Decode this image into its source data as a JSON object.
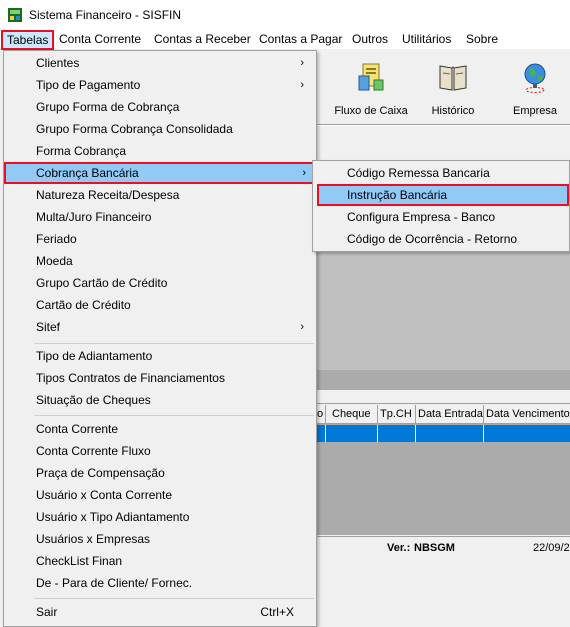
{
  "window": {
    "title": "Sistema Financeiro - SISFIN",
    "icon": "sisfin-app-icon"
  },
  "menubar": {
    "items": [
      "Tabelas",
      "Conta Corrente",
      "Contas a Receber",
      "Contas a Pagar",
      "Outros",
      "Utilitários",
      "Sobre"
    ]
  },
  "toolbar": {
    "buttons": [
      {
        "label": "Fluxo de Caixa",
        "icon": "cash-flow-icon"
      },
      {
        "label": "Histórico",
        "icon": "book-icon"
      },
      {
        "label": "Empresa",
        "icon": "globe-icon"
      }
    ]
  },
  "tabelas_menu": {
    "items": [
      {
        "label": "Clientes",
        "submenu": true
      },
      {
        "label": "Tipo de Pagamento",
        "submenu": true
      },
      {
        "label": "Grupo Forma de Cobrança"
      },
      {
        "label": "Grupo Forma Cobrança Consolidada"
      },
      {
        "label": "Forma Cobrança"
      },
      {
        "label": "Cobrança Bancária",
        "submenu": true,
        "highlighted": true
      },
      {
        "label": "Natureza Receita/Despesa"
      },
      {
        "label": "Multa/Juro Financeiro"
      },
      {
        "label": "Feriado"
      },
      {
        "label": "Moeda"
      },
      {
        "label": "Grupo Cartão de Crédito"
      },
      {
        "label": "Cartão de Crédito"
      },
      {
        "label": "Sitef",
        "submenu": true
      },
      {
        "label": "Tipo de Adiantamento"
      },
      {
        "label": "Tipos Contratos de Financiamentos"
      },
      {
        "label": "Situação de Cheques"
      },
      {
        "label": "Conta Corrente"
      },
      {
        "label": "Conta Corrente Fluxo"
      },
      {
        "label": "Praça de Compensação"
      },
      {
        "label": "Usuário x Conta Corrente"
      },
      {
        "label": "Usuário x Tipo Adiantamento"
      },
      {
        "label": "Usuários x Empresas"
      },
      {
        "label": "CheckList Finan"
      },
      {
        "label": "De - Para de Cliente/ Fornec."
      },
      {
        "label": "Sair",
        "shortcut": "Ctrl+X"
      }
    ],
    "arrow_glyph": "›"
  },
  "cobranca_submenu": {
    "items": [
      {
        "label": "Código Remessa Bancaria"
      },
      {
        "label": "Instrução Bancária",
        "highlighted": true
      },
      {
        "label": "Configura Empresa - Banco"
      },
      {
        "label": "Código de Ocorrência - Retorno"
      }
    ]
  },
  "grid": {
    "columns": [
      "o",
      "Cheque",
      "Tp.CH",
      "Data Entrada",
      "Data Vencimento"
    ]
  },
  "statusbar": {
    "version_label": "Ver.:",
    "version_value": "NBSGM",
    "date": "22/09/2"
  },
  "colors": {
    "highlight": "#91c9f7",
    "highlight_border": "#e81123",
    "selection_row": "#0078d7"
  }
}
